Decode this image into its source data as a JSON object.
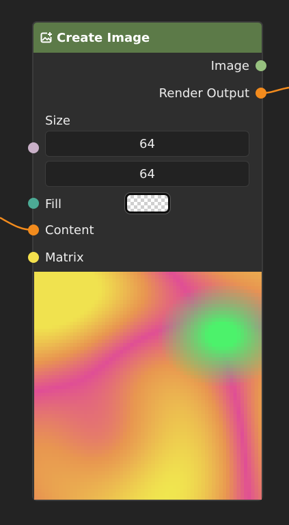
{
  "node": {
    "title": "Create Image",
    "header_icon": "image-plus-icon",
    "header_color": "#5c7a48"
  },
  "outputs": [
    {
      "label": "Image",
      "socket_color": "#97c17f"
    },
    {
      "label": "Render Output",
      "socket_color": "#f28b1d"
    }
  ],
  "inputs": {
    "size": {
      "label": "Size",
      "socket_color": "#c9b0c8",
      "width": "64",
      "height": "64"
    },
    "fill": {
      "label": "Fill",
      "socket_color": "#4caa95",
      "swatch": "transparent-checker"
    },
    "content": {
      "label": "Content",
      "socket_color": "#f28b1d"
    },
    "matrix": {
      "label": "Matrix",
      "socket_color": "#f4e04d"
    }
  },
  "preview": {
    "description_icon": "image-preview",
    "palette": [
      "#f0e24f",
      "#e06a9a",
      "#4cf26b",
      "#e8a050",
      "#e24e95"
    ]
  },
  "wires": {
    "color": "#f28b1d"
  }
}
